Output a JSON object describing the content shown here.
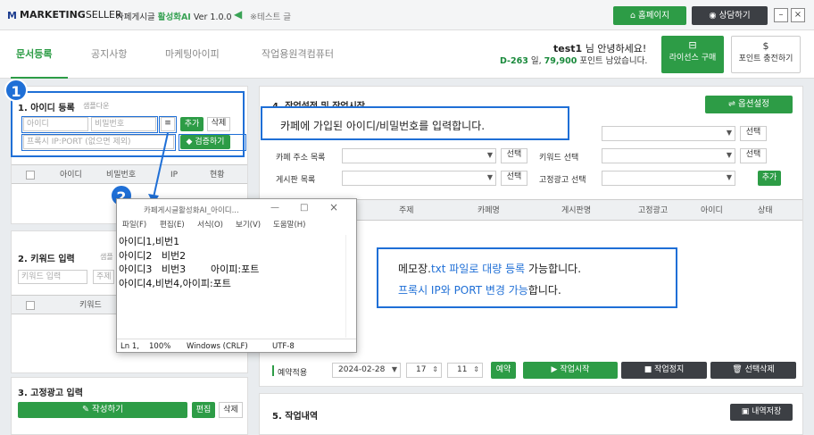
{
  "titlebar": {
    "brand_bold": "MARKETING",
    "brand_rest": "SELLER",
    "product": "카페게시글",
    "product_hl": "활성화AI",
    "version": "Ver 1.0.0",
    "notice": "※테스트 글",
    "homepage_btn": "홈페이지",
    "consult_btn": "상담하기",
    "minimize": "–",
    "close": "×"
  },
  "nav": {
    "tabs": [
      "문서등록",
      "공지사항",
      "마케팅아이피",
      "작업용원격컴퓨터"
    ],
    "user_name": "test1",
    "user_greet": "님 안녕하세요!",
    "dday": "D-263",
    "days_text": "일,",
    "points": "79,900",
    "points_text": "포인트 남았습니다.",
    "license_btn": "라이선스 구매",
    "points_btn": "포인트 충전하기"
  },
  "left": {
    "id_section": "1. 아이디 등록",
    "id_sample": "샘플다운",
    "id_placeholder": "아이디",
    "pw_placeholder": "비밀번호",
    "proxy_placeholder": "프록시 IP:PORT (없으면 제외)",
    "add_btn": "추가",
    "delete_btn": "삭제",
    "verify_btn": "검증하기",
    "id_table_headers": [
      "아이디",
      "비밀번호",
      "IP",
      "현황"
    ],
    "kw_section": "2. 키워드 입력",
    "kw_sample": "샘플",
    "kw_placeholder": "키워드 입력",
    "kw_title_placeholder": "주제",
    "kw_table_header": "키워드",
    "ad_section": "3. 고정광고 입력",
    "write_btn": "작성하기",
    "edit_btn": "편집",
    "ad_delete_btn": "삭제"
  },
  "right": {
    "work_section": "4. 작업설정 및 작업시작",
    "option_btn": "옵션설정",
    "cafe_addr_label": "카페 주소 목록",
    "board_label": "게시판 목록",
    "keyword_select_label": "키워드 선택",
    "fixed_ad_label": "고정광고 선택",
    "select_btn": "선택",
    "add_btn": "추가",
    "table_headers": [
      "주제",
      "카페명",
      "게시판명",
      "고정광고",
      "아이디",
      "상태"
    ],
    "reserve_label": "예약적용",
    "date": "2024-02-28",
    "hour": "17",
    "minute": "11",
    "reserve_btn": "예약",
    "start_btn": "작업시작",
    "stop_btn": "작업정지",
    "del_btn": "선택삭제",
    "history_section": "5. 작업내역",
    "history_save": "내역저장"
  },
  "callouts": {
    "badge1": "1",
    "badge2": "2",
    "text1": "카페에 가입된 아이디/비밀번호를 입력합니다.",
    "text2_a": "메모장.",
    "text2_b": "txt 파일로 대량 등록",
    "text2_c": " 가능합니다.",
    "text3_a": "프록시 IP와 PORT 변경 가능",
    "text3_b": "합니다."
  },
  "notepad": {
    "title": "카페게시글활성화AI_아이디...",
    "menu": [
      "파일(F)",
      "편집(E)",
      "서식(O)",
      "보기(V)",
      "도움말(H)"
    ],
    "lines": [
      "아이디1,비번1",
      "아이디2   비번2",
      "아이디3   비번3        아이피:포트",
      "아이디4,비번4,아이피:포트"
    ],
    "status": [
      "Ln 1,",
      "100%",
      "Windows (CRLF)",
      "UTF-8"
    ]
  },
  "colors": {
    "green": "#2d9c46",
    "blue": "#1f6fd6",
    "dark": "#3c3f44"
  }
}
